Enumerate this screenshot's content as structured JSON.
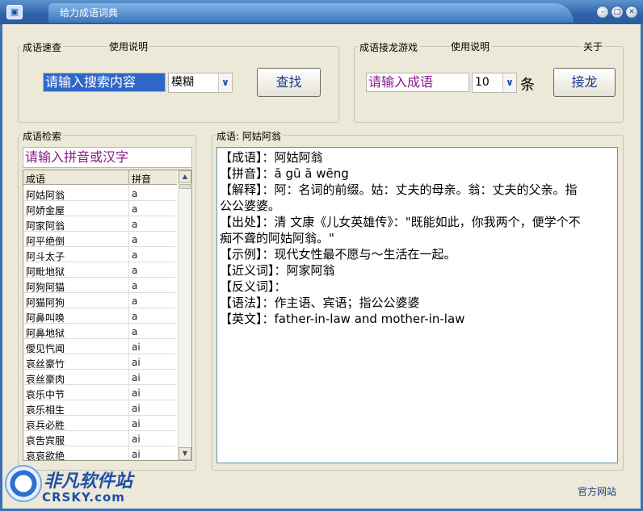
{
  "window": {
    "title": "给力成语词典",
    "app_icon": "app-icon"
  },
  "left_group": {
    "label": "成语速查",
    "help_label": "使用说明",
    "search_input": "请输入搜索内容",
    "mode_select": "模糊",
    "search_button": "查找"
  },
  "right_group": {
    "label": "成语接龙游戏",
    "help_label": "使用说明",
    "about_label": "关于",
    "idiom_input": "请输入成语",
    "count_select": "10",
    "count_unit": "条",
    "chain_button": "接龙"
  },
  "index_panel": {
    "label": "成语检索",
    "filter_input": "请输入拼音或汉字",
    "col_idiom": "成语",
    "col_pinyin": "拼音",
    "rows": [
      {
        "idiom": "阿姑阿翁",
        "pinyin": "a"
      },
      {
        "idiom": "阿娇金屋",
        "pinyin": "a"
      },
      {
        "idiom": "阿家阿翁",
        "pinyin": "a"
      },
      {
        "idiom": "阿平绝倒",
        "pinyin": "a"
      },
      {
        "idiom": "阿斗太子",
        "pinyin": "a"
      },
      {
        "idiom": "阿毗地狱",
        "pinyin": "a"
      },
      {
        "idiom": "阿狗阿猫",
        "pinyin": "a"
      },
      {
        "idiom": "阿猫阿狗",
        "pinyin": "a"
      },
      {
        "idiom": "阿鼻叫唤",
        "pinyin": "a"
      },
      {
        "idiom": "阿鼻地狱",
        "pinyin": "a"
      },
      {
        "idiom": "僾见忾闻",
        "pinyin": "ai"
      },
      {
        "idiom": "哀丝豪竹",
        "pinyin": "ai"
      },
      {
        "idiom": "哀丝豪肉",
        "pinyin": "ai"
      },
      {
        "idiom": "哀乐中节",
        "pinyin": "ai"
      },
      {
        "idiom": "哀乐相生",
        "pinyin": "ai"
      },
      {
        "idiom": "哀兵必胜",
        "pinyin": "ai"
      },
      {
        "idiom": "哀吿宾服",
        "pinyin": "ai"
      },
      {
        "idiom": "哀哀欲绝",
        "pinyin": "ai"
      }
    ]
  },
  "detail_panel": {
    "label": "成语: 阿姑阿翁",
    "lines": [
      "【成语】：阿姑阿翁",
      "【拼音】：ā gū ā wēng",
      "【解释】：阿：名词的前缀。姑：丈夫的母亲。翁：丈夫的父亲。指",
      "公公婆婆。",
      "【出处】：清 文康《儿女英雄传》：\"既能如此，你我两个，便学个不",
      "痴不聋的阿姑阿翁。\"",
      "【示例】：现代女性最不愿与～生活在一起。",
      "【近义词】：阿家阿翁",
      "【反义词】：",
      "【语法】：作主语、宾语；指公公婆婆",
      "【英文】：father-in-law and mother-in-law"
    ]
  },
  "footer": {
    "official_site": "官方网站",
    "watermark_cn": "非凡软件站",
    "watermark_en": "CRSKY.com"
  }
}
